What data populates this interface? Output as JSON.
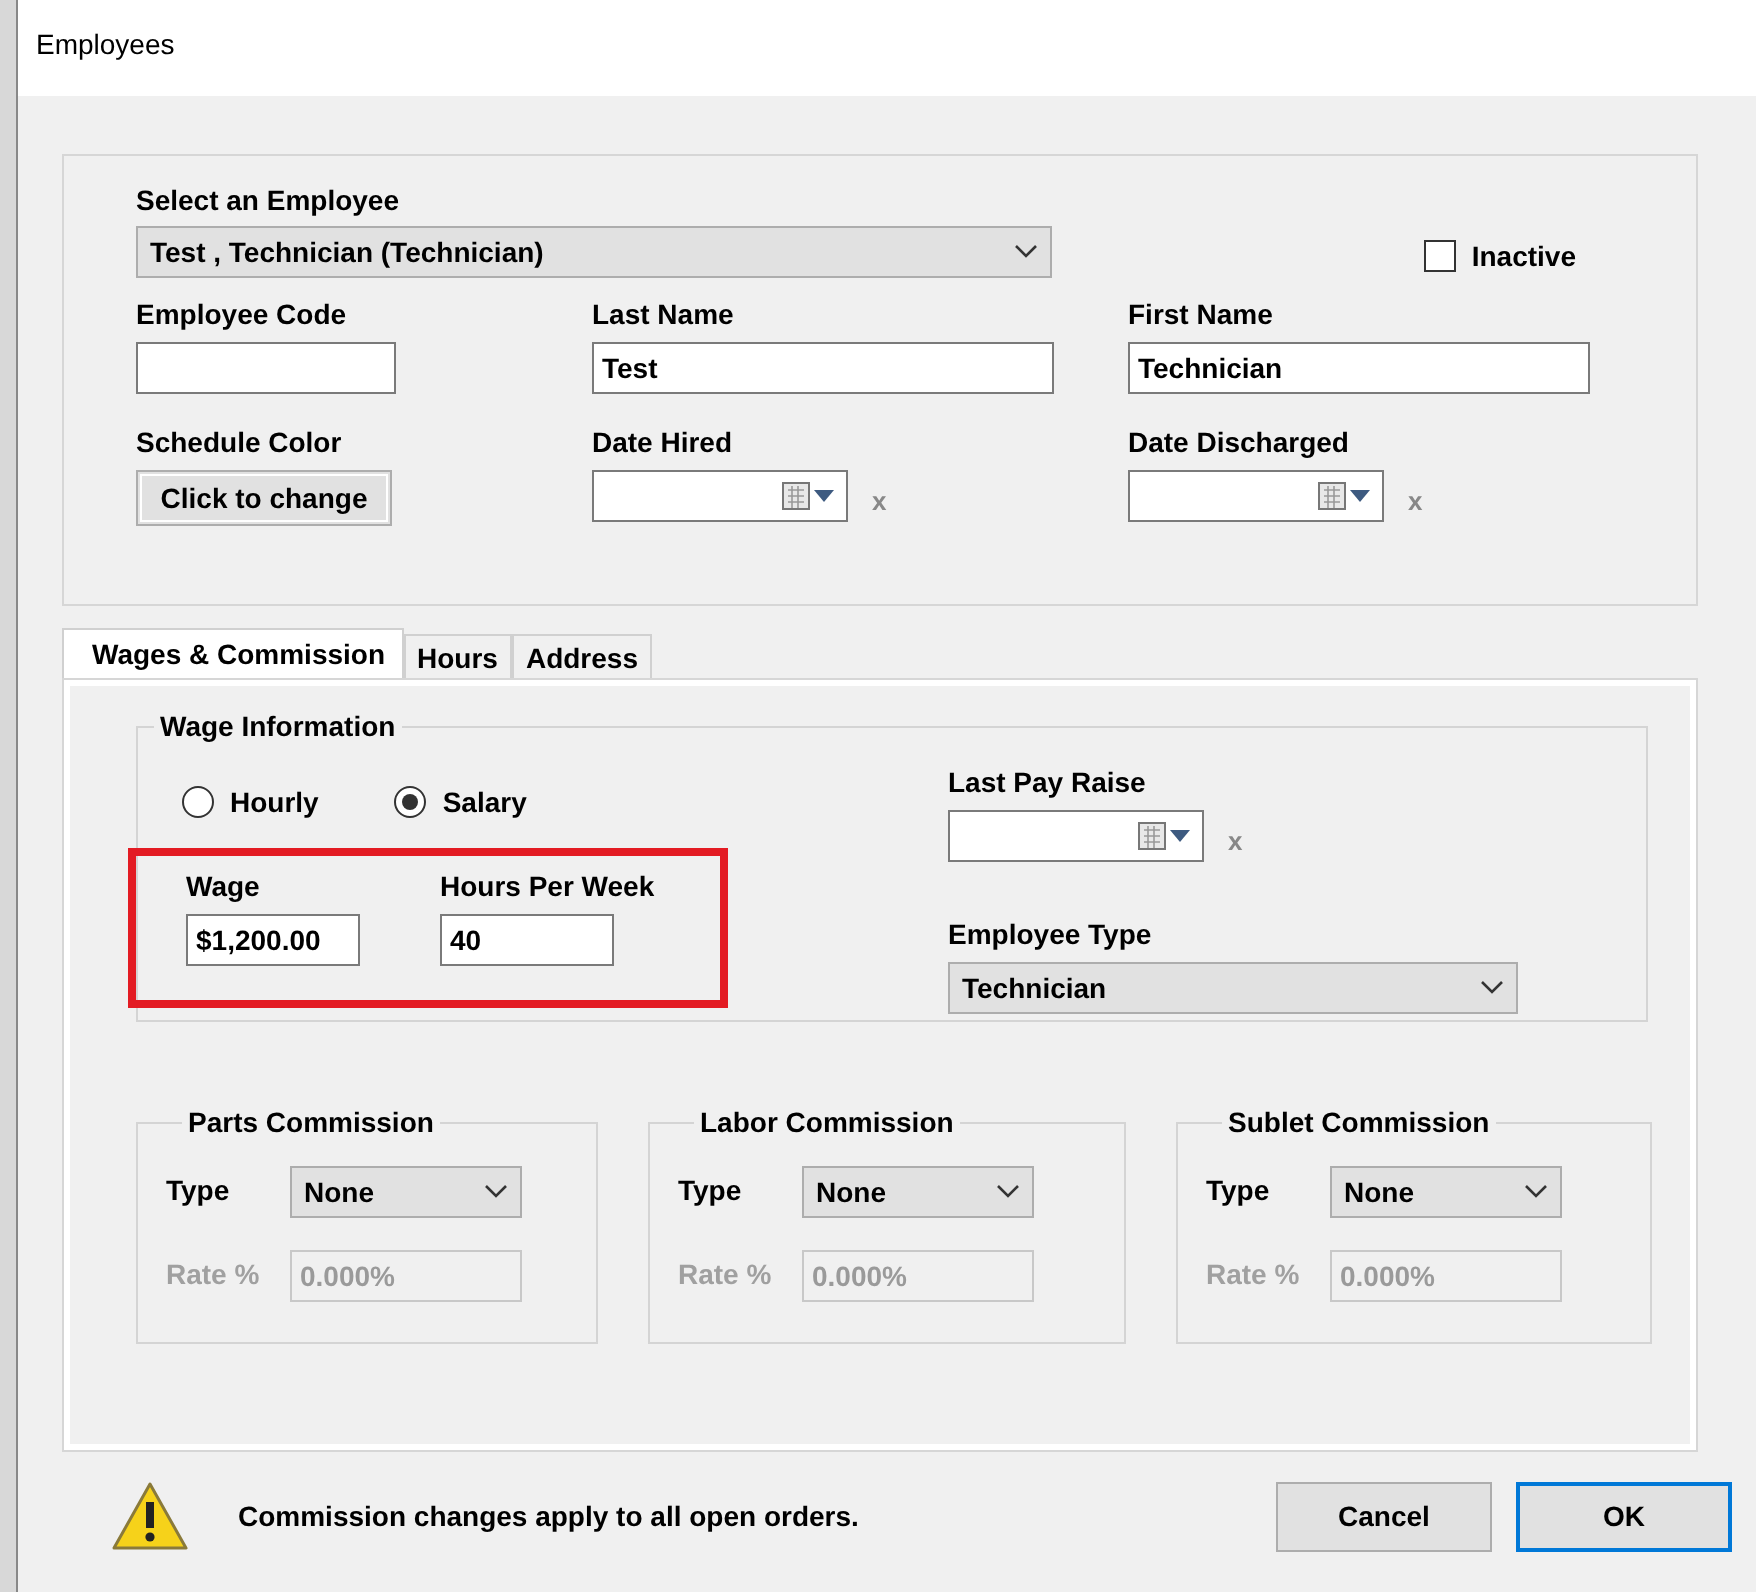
{
  "window": {
    "title": "Employees"
  },
  "employee_select": {
    "label": "Select an Employee",
    "value": "Test , Technician  (Technician)"
  },
  "inactive": {
    "label": "Inactive",
    "checked": false
  },
  "fields": [
    {
      "kind": "text",
      "label": "Employee Code"
    },
    {
      "kind": "text",
      "label": "Last Name",
      "value": "Test"
    },
    {
      "kind": "text",
      "label": "First Name",
      "value": "Technician"
    },
    {
      "kind": "color",
      "label": "Schedule Color",
      "value": "Click to change"
    },
    {
      "kind": "date",
      "label": "Date Hired",
      "clear": "x"
    },
    {
      "kind": "date",
      "label": "Date Discharged",
      "clear": "x"
    }
  ],
  "tabs": [
    {
      "label": "Wages & Commission",
      "selected": true
    },
    {
      "label": "Hours",
      "selected": false
    },
    {
      "label": "Address",
      "selected": false
    }
  ],
  "wage_information": {
    "title": "Wage Information",
    "pay_basis": [
      {
        "label": "Hourly",
        "selected": false
      },
      {
        "label": "Salary",
        "selected": true
      }
    ],
    "highlighted": true,
    "wage": {
      "label": "Wage",
      "value": "$1,200.00"
    },
    "hours_per_week": {
      "label": "Hours Per Week",
      "value": "40"
    },
    "last_pay_raise": {
      "label": "Last Pay Raise",
      "clear": "x"
    },
    "employee_type": {
      "label": "Employee Type",
      "value": "Technician"
    }
  },
  "commissions": [
    {
      "title": "Parts Commission",
      "type_label": "Type",
      "type": "None",
      "rate_label": "Rate %",
      "rate": "0.000%",
      "disabled": true
    },
    {
      "title": "Labor Commission",
      "type_label": "Type",
      "type": "None",
      "rate_label": "Rate %",
      "rate": "0.000%",
      "disabled": true
    },
    {
      "title": "Sublet Commission",
      "type_label": "Type",
      "type": "None",
      "rate_label": "Rate %",
      "rate": "0.000%",
      "disabled": true
    }
  ],
  "footer": {
    "message": "Commission changes apply to all open orders.",
    "buttons": [
      {
        "label": "Cancel",
        "default": false
      },
      {
        "label": "OK",
        "default": true
      }
    ]
  }
}
